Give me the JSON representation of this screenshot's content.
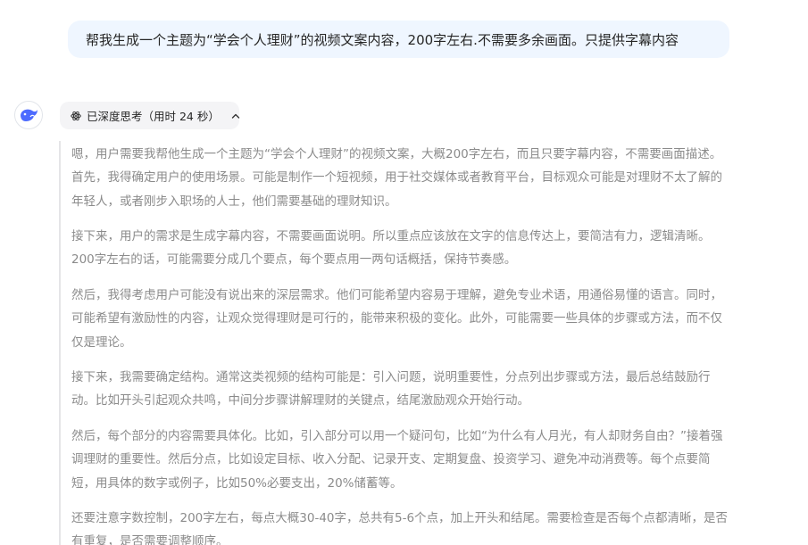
{
  "user_message": {
    "text": "帮我生成一个主题为“学会个人理财”的视频文案内容，200字左右.不需要多余画面。只提供字幕内容"
  },
  "assistant": {
    "avatar_icon": "deepseek-whale-icon",
    "thinking_toggle": {
      "icon": "atom-icon",
      "label": "已深度思考（用时 24 秒）",
      "chevron": "chevron-up-icon"
    },
    "thinking_paragraphs": [
      "嗯，用户需要我帮他生成一个主题为“学会个人理财”的视频文案，大概200字左右，而且只要字幕内容，不需要画面描述。首先，我得确定用户的使用场景。可能是制作一个短视频，用于社交媒体或者教育平台，目标观众可能是对理财不太了解的年轻人，或者刚步入职场的人士，他们需要基础的理财知识。",
      "接下来，用户的需求是生成字幕内容，不需要画面说明。所以重点应该放在文字的信息传达上，要简洁有力，逻辑清晰。200字左右的话，可能需要分成几个要点，每个要点用一两句话概括，保持节奏感。",
      "然后，我得考虑用户可能没有说出来的深层需求。他们可能希望内容易于理解，避免专业术语，用通俗易懂的语言。同时，可能希望有激励性的内容，让观众觉得理财是可行的，能带来积极的变化。此外，可能需要一些具体的步骤或方法，而不仅仅是理论。",
      "接下来，我需要确定结构。通常这类视频的结构可能是：引入问题，说明重要性，分点列出步骤或方法，最后总结鼓励行动。比如开头引起观众共鸣，中间分步骤讲解理财的关键点，结尾激励观众开始行动。",
      "然后，每个部分的内容需要具体化。比如，引入部分可以用一个疑问句，比如“为什么有人月光，有人却财务自由？”接着强调理财的重要性。然后分点，比如设定目标、收入分配、记录开支、定期复盘、投资学习、避免冲动消费等。每个点要简短，用具体的数字或例子，比如50%必要支出，20%储蓄等。",
      "还要注意字数控制，200字左右，每点大概30-40字，总共有5-6个点，加上开头和结尾。需要检查是否每个点都清晰，是否有重复，是否需要调整顺序。"
    ]
  }
}
